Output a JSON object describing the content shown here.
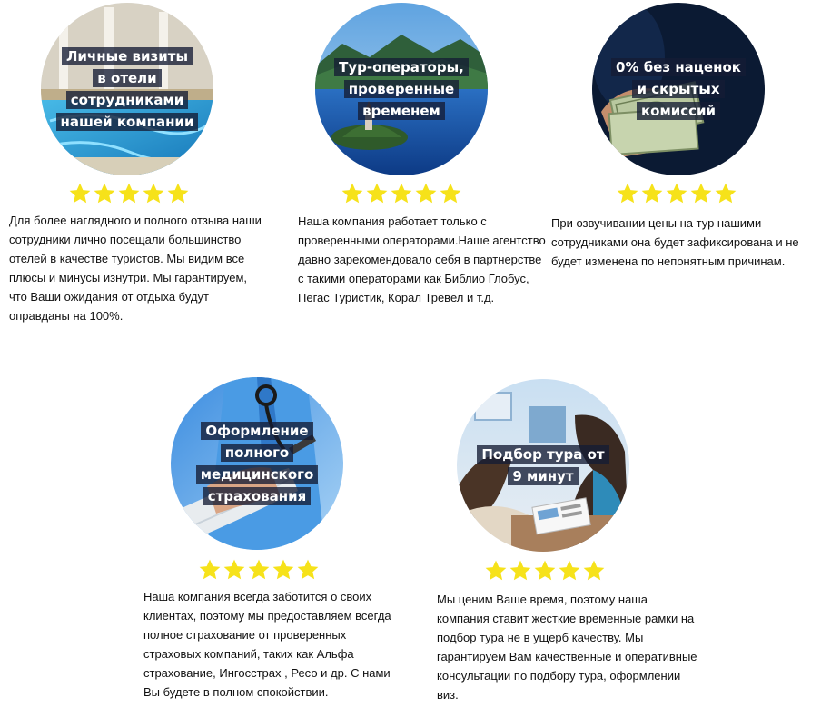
{
  "colors": {
    "star": "#f6e21a",
    "caption_bg": "#141c34",
    "text": "#111111"
  },
  "features": [
    {
      "icon": "hotel-pool-photo",
      "caption": [
        "Личные визиты",
        "в отели",
        "сотрудниками",
        "нашей компании"
      ],
      "rating": 5,
      "description": "Для  более наглядного  и  полного отзыва наши сотрудники лично посещали большинство отелей в качестве туристов. Мы видим все плюсы и минусы изнутри. Мы гарантируем, что Ваши ожидания от отдыха будут оправданы на 100%."
    },
    {
      "icon": "lake-island-photo",
      "caption": [
        "Тур-операторы,",
        "проверенные",
        "временем"
      ],
      "rating": 5,
      "description": "Наша компания работает только с проверенными операторами.Наше агентство давно зарекомендовало себя в партнерстве с такими  операторами как Библио Глобус, Пегас Туристик, Корал Тревел и т.д."
    },
    {
      "icon": "money-hand-photo",
      "caption": [
        "0% без наценок",
        "и скрытых",
        "комиссий"
      ],
      "rating": 5,
      "description": "При  озвучивании цены на тур  нашими сотрудниками она будет зафиксирована и не будет изменена по непонятным причинам."
    },
    {
      "icon": "doctor-photo",
      "caption": [
        "Оформление",
        "полного",
        "медицинского",
        "страхования"
      ],
      "rating": 5,
      "description": "Наша компания всегда заботится о своих клиентах, поэтому мы предоставляем всегда полное  страхование от проверенных страховых компаний, таких как Альфа страхование,  Ингосстрах , Ресо и др. С нами Вы будете в полном спокойствии."
    },
    {
      "icon": "consultation-photo",
      "caption": [
        "Подбор тура от",
        "9 минут"
      ],
      "rating": 5,
      "description": "Мы ценим Ваше время, поэтому наша компания ставит жесткие временные рамки на подбор тура не в ущерб качеству. Мы гарантируем Вам качественные  и оперативные консультации  по подбору тура, оформлении виз."
    }
  ]
}
